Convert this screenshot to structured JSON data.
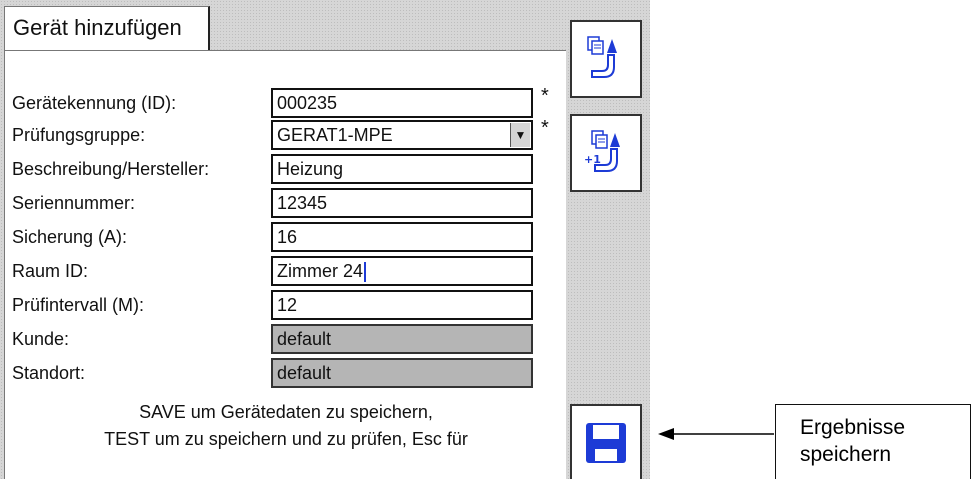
{
  "tab": {
    "title": "Gerät hinzufügen"
  },
  "form": {
    "fields": [
      {
        "label": "Gerätekennung (ID):",
        "value": "000235",
        "required": "*"
      },
      {
        "label": "Prüfungsgruppe:",
        "value": "GERAT1-MPE",
        "required": "*"
      },
      {
        "label": "Beschreibung/Hersteller:",
        "value": "Heizung"
      },
      {
        "label": "Seriennummer:",
        "value": "12345"
      },
      {
        "label": "Sicherung (A):",
        "value": "16"
      },
      {
        "label": "Raum ID:",
        "value": "Zimmer 24"
      },
      {
        "label": "Prüfintervall (M):",
        "value": "12"
      },
      {
        "label": "Kunde:",
        "value": "default"
      },
      {
        "label": "Standort:",
        "value": "default"
      }
    ],
    "message_line1": "SAVE um Gerätedaten zu speichern,",
    "message_line2": "TEST um zu speichern und zu prüfen, Esc für"
  },
  "sidebar": {
    "buttons": [
      {
        "icon": "copy-device-icon"
      },
      {
        "icon": "copy-device-increment-icon"
      },
      {
        "icon": "save-disk-icon"
      }
    ]
  },
  "callout": {
    "line1": "Ergebnisse",
    "line2": "speichern"
  },
  "colors": {
    "accent": "#1d3bd6",
    "readonly": "#b5b5b5"
  }
}
